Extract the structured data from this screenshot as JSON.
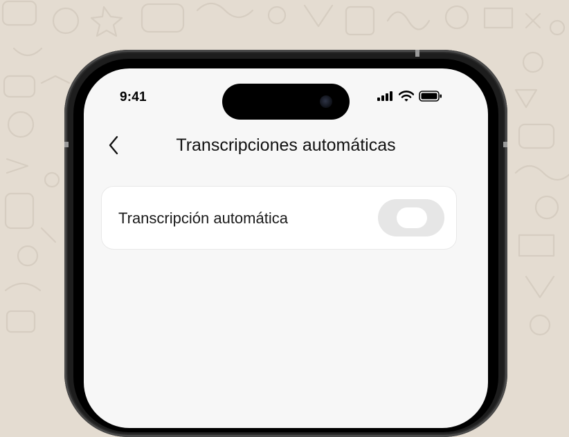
{
  "status_bar": {
    "time": "9:41",
    "icons": [
      "cellular-signal-icon",
      "wifi-icon",
      "battery-icon"
    ]
  },
  "header": {
    "back_icon": "chevron-left-icon",
    "title": "Transcripciones automáticas"
  },
  "settings": {
    "auto_transcription": {
      "label": "Transcripción automática",
      "enabled": false
    }
  },
  "colors": {
    "background": "#e4dcd1",
    "screen": "#f7f7f7",
    "card": "#ffffff",
    "toggle_off_track": "#e6e6e6"
  }
}
